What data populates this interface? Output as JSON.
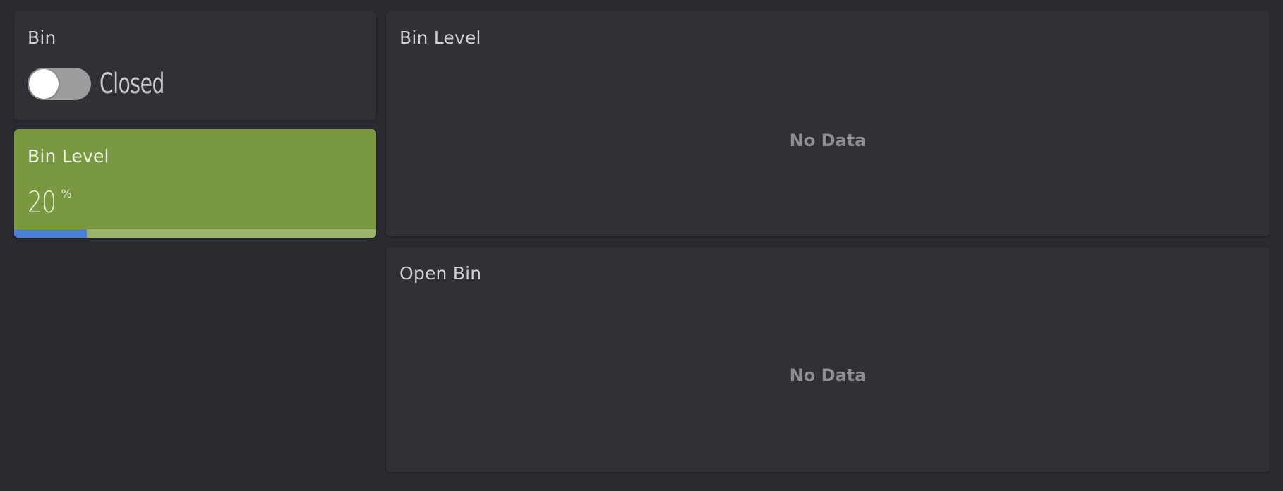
{
  "bin_switch": {
    "title": "Bin",
    "state_label": "Closed",
    "is_on": false
  },
  "bin_level_gauge": {
    "title": "Bin Level",
    "value": "20",
    "unit": "%",
    "progress_percent": 20,
    "colors": {
      "background": "#7a983f",
      "bar": "#4a7fd6"
    }
  },
  "charts": [
    {
      "title": "Bin Level",
      "empty_message": "No Data"
    },
    {
      "title": "Open Bin",
      "empty_message": "No Data"
    }
  ],
  "colors": {
    "page_background": "#2a2b30",
    "card_background": "#303136"
  }
}
